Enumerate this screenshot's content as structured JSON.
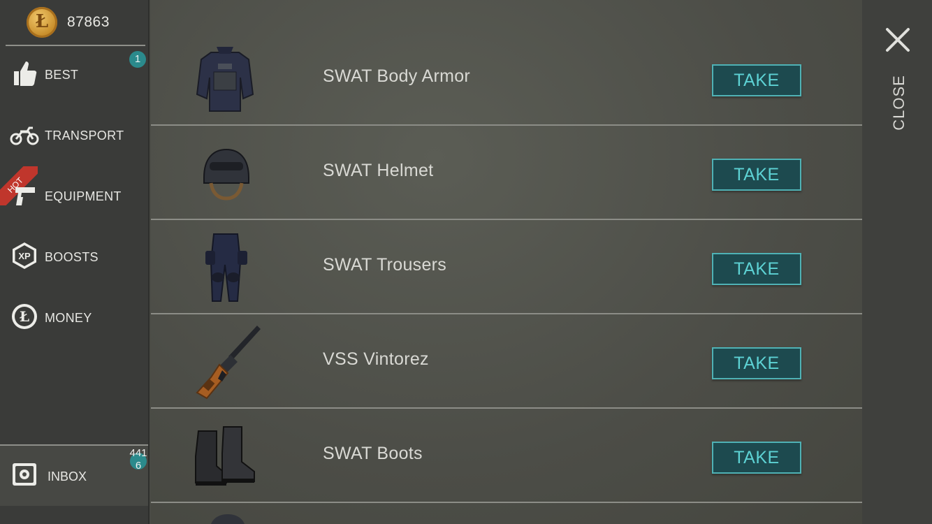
{
  "currency": {
    "icon": "coin-icon",
    "glyph": "Ł",
    "amount": "87863"
  },
  "nav": [
    {
      "id": "best",
      "label": "BEST",
      "icon": "thumbs-up-icon",
      "badge": "1"
    },
    {
      "id": "transport",
      "label": "TRANSPORT",
      "icon": "motorcycle-icon"
    },
    {
      "id": "equipment",
      "label": "EQUIPMENT",
      "icon": "pistol-icon",
      "ribbon": "HOT"
    },
    {
      "id": "boosts",
      "label": "BOOSTS",
      "icon": "xp-icon",
      "icon_text": "XP"
    },
    {
      "id": "money",
      "label": "MONEY",
      "icon": "money-coin-icon",
      "icon_text": "Ł"
    }
  ],
  "inbox": {
    "label": "INBOX",
    "icon": "safe-icon",
    "badge_line1": "441",
    "badge_line2": "6"
  },
  "items": [
    {
      "name": "SWAT Body Armor",
      "icon": "body-armor-icon",
      "button": "TAKE"
    },
    {
      "name": "SWAT Helmet",
      "icon": "helmet-icon",
      "button": "TAKE"
    },
    {
      "name": "SWAT Trousers",
      "icon": "trousers-icon",
      "button": "TAKE"
    },
    {
      "name": "VSS Vintorez",
      "icon": "rifle-icon",
      "button": "TAKE"
    },
    {
      "name": "SWAT Boots",
      "icon": "boots-icon",
      "button": "TAKE"
    }
  ],
  "close": {
    "label": "CLOSE",
    "icon": "close-icon"
  },
  "colors": {
    "accent": "#4fb2b5",
    "button_bg": "#1d4a4f",
    "badge": "#2b8a8c",
    "hot": "#c0362c"
  }
}
